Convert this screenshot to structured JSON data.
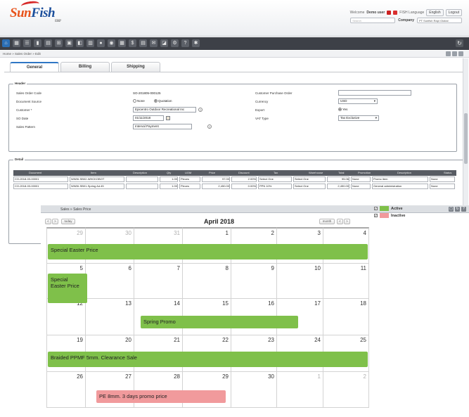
{
  "app": {
    "logo_sun": "Sun",
    "logo_fish": "Fish",
    "logo_suffix": "ERP"
  },
  "header": {
    "welcome": "Welcome",
    "user": "Demo user",
    "language": "FISH Language",
    "language_value": "English",
    "logout": "Logout",
    "search_placeholder": "Search",
    "company_label": "Company",
    "company_value": "PT Sunfish Rapi Global"
  },
  "breadcrumb": "Home  »  Sales Order  »  Edit",
  "tabs": [
    "General",
    "Billing",
    "Shipping"
  ],
  "header_section": {
    "legend": "Header",
    "fields": {
      "so_code_label": "Sales Order Code",
      "so_code_value": "SO-201805-000125",
      "source_label": "Document Source",
      "source_opt1": "None",
      "source_opt2": "Quotation",
      "customer_label": "Customer *",
      "customer_value": "Epicentro Outdoor Recreational Inc",
      "so_date_label": "SO Date",
      "so_date_value": "01/11/2018",
      "pattern_label": "Sales Pattern",
      "pattern_value": "Interval Payment",
      "po_label": "Customer Purchase Order",
      "po_value": "",
      "currency_label": "Currency",
      "currency_value": "USD",
      "export_label": "Export",
      "export_value": "Yes",
      "vat_label": "VAT Type",
      "vat_value": "Tax Exclusive"
    }
  },
  "detail_section": {
    "legend": "Detail",
    "columns": [
      "Document",
      "Item",
      "Description",
      "Qty",
      "UOM",
      "Price",
      "Discount",
      "Tax",
      "Warehouse",
      "Total",
      "Promotion",
      "Description",
      "Status"
    ],
    "rows": [
      [
        "CO-2018-03-00001",
        "WWW-SB02-WHCKOBOT",
        "",
        "1.00",
        "Pieces",
        "97.00",
        "2.00%",
        "Select One",
        "Select One",
        "95.06",
        "None",
        "Promo item",
        "None"
      ],
      [
        "CO-2018-03-00001",
        "WWW-SB01-Spring Ad.45",
        "",
        "1.00",
        "Pieces",
        "2,450.00",
        "0.00%",
        "PPN 10%",
        "Select One",
        "2,450.00",
        "None",
        "General administration",
        "None"
      ]
    ]
  },
  "overlay": {
    "title": "Sales  »  Sales Price",
    "nav_prev": "<",
    "nav_next": ">",
    "nav_today": "today",
    "view_month": "month",
    "view_prev": "<",
    "view_next": ">",
    "calendar_title": "April 2018"
  },
  "legend": [
    {
      "label": "Active",
      "color": "#7fc04a",
      "checked": true
    },
    {
      "label": "Inactive",
      "color": "#f19a9c",
      "checked": true
    }
  ],
  "calendar": {
    "weeks": [
      [
        "29",
        "30",
        "31",
        "1",
        "2",
        "3",
        "4"
      ],
      [
        "5",
        "6",
        "7",
        "8",
        "9",
        "10",
        "11"
      ],
      [
        "12",
        "13",
        "14",
        "15",
        "16",
        "17",
        "18"
      ],
      [
        "19",
        "20",
        "21",
        "22",
        "23",
        "24",
        "25"
      ],
      [
        "26",
        "27",
        "28",
        "29",
        "30",
        "1",
        "2"
      ]
    ],
    "other_month": [
      [
        0,
        0
      ],
      [
        0,
        1
      ],
      [
        0,
        2
      ],
      [
        4,
        5
      ],
      [
        4,
        6
      ]
    ],
    "events": [
      {
        "label": "Special Easter Price",
        "color": "green"
      },
      {
        "label": "Special Easter Price",
        "color": "green"
      },
      {
        "label": "Spring Promo",
        "color": "green"
      },
      {
        "label": "Braided PPMF 5mm. Clearance Sale",
        "color": "green"
      },
      {
        "label": "PE 8mm. 3 days promo price",
        "color": "pink"
      }
    ]
  }
}
